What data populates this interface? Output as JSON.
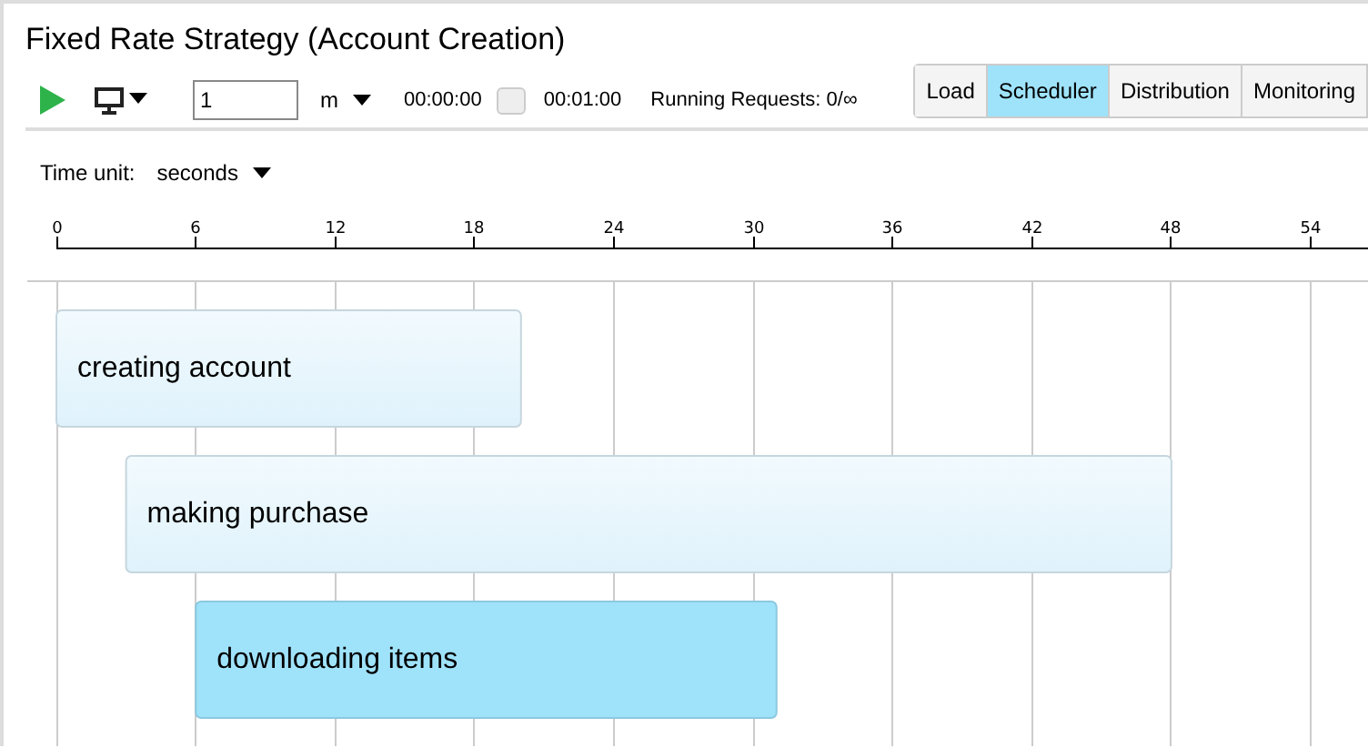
{
  "title": "Fixed Rate Strategy (Account Creation)",
  "toolbar": {
    "duration_value": "1",
    "duration_unit": "m",
    "elapsed": "00:00:00",
    "progress": {
      "level": 0
    },
    "total": "00:01:00",
    "running_requests": "Running Requests: 0/∞"
  },
  "tabs": [
    {
      "label": "Load",
      "selected": false
    },
    {
      "label": "Scheduler",
      "selected": true
    },
    {
      "label": "Distribution",
      "selected": false
    },
    {
      "label": "Monitoring",
      "selected": false
    }
  ],
  "time_unit": {
    "label": "Time unit:",
    "value": "seconds"
  },
  "axis_ticks": [
    "0",
    "6",
    "12",
    "18",
    "24",
    "30",
    "36",
    "42",
    "48",
    "54"
  ],
  "bars": [
    {
      "label": "creating account",
      "selected": false
    },
    {
      "label": "making purchase",
      "selected": false
    },
    {
      "label": "downloading items",
      "selected": true
    }
  ]
}
